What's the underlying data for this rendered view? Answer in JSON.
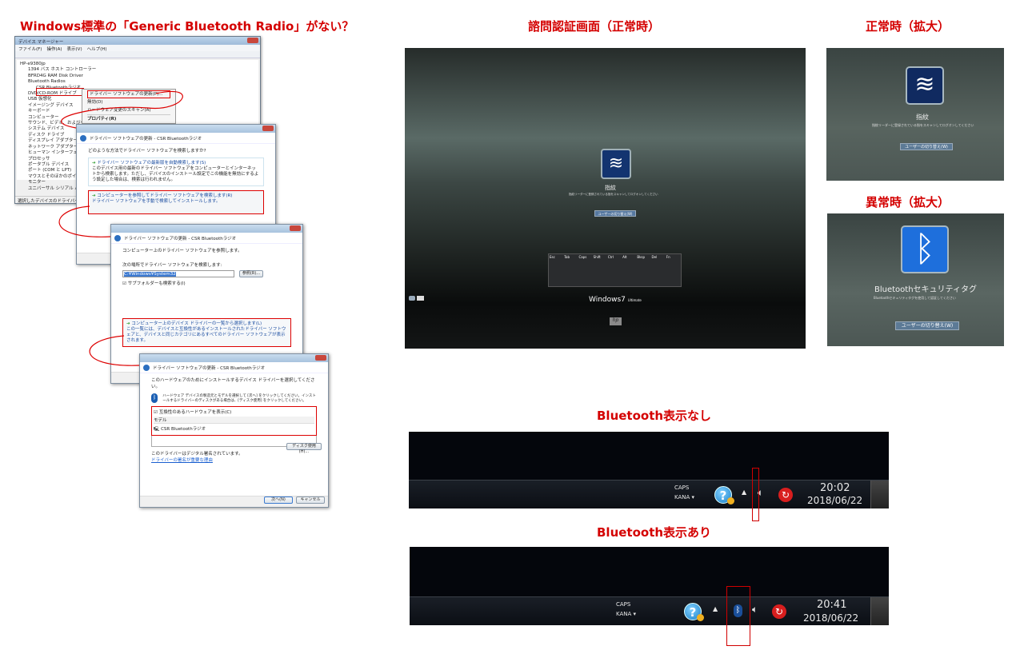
{
  "headings": {
    "left": "Windows標準の「Generic Bluetooth Radio」がない？",
    "center": "諮問認証画面（正常時）",
    "normal_zoom": "正常時（拡大）",
    "abnormal_zoom": "異常時（拡大）",
    "tray_without": "Bluetooth表示なし",
    "tray_with": "Bluetooth表示あり"
  },
  "device_manager": {
    "title": "デバイス マネージャー",
    "menu": [
      "ファイル(F)",
      "操作(A)",
      "表示(V)",
      "ヘルプ(H)"
    ],
    "tree": [
      "HP-e9380jp",
      "1394 バス ホスト コントローラー",
      "BFRD4G RAM Disk Driver",
      "Bluetooth Radios",
      "CSR Bluetoothラジオ",
      "DVD/CD-ROM ドライブ",
      "USB 仮想化",
      "イメージング デバイス",
      "キーボード",
      "コンピューター",
      "サウンド、ビデオ、およびゲーム",
      "システム デバイス",
      "ディスク ドライブ",
      "ディスプレイ アダプター",
      "ネットワーク アダプター",
      "ヒューマン インターフェイス",
      "プロセッサ",
      "ポータブル デバイス",
      "ポート (COM と LPT)",
      "マウスとそのほかのポインティング",
      "モニター",
      "ユニバーサル シリアル バス"
    ],
    "context_menu": [
      "ドライバー ソフトウェアの更新(P)...",
      "無効(D)",
      "ハードウェア変更のスキャン(A)",
      "プロパティ(R)"
    ],
    "status": "選択したデバイスのドライバー ソフトウェア"
  },
  "dialog1": {
    "title": "ドライバー ソフトウェアの更新 - CSR Bluetoothラジオ",
    "question": "どのような方法でドライバー ソフトウェアを検索しますか?",
    "opt1_title": "ドライバー ソフトウェアの最新版を自動検索します(S)",
    "opt1_desc": "このデバイス用の最新のドライバー ソフトウェアをコンピューターとインターネットから検索します。ただし、デバイスのインストール設定でこの機能を無効にするよう設定した場合は、検索は行われません。",
    "opt2_title": "コンピューターを参照してドライバー ソフトウェアを検索します(R)",
    "opt2_desc": "ドライバー ソフトウェアを手動で検索してインストールします。"
  },
  "dialog2": {
    "title": "ドライバー ソフトウェアの更新 - CSR Bluetoothラジオ",
    "heading": "コンピューター上のドライバー ソフトウェアを参照します。",
    "search_label": "次の場所でドライバー ソフトウェアを検索します:",
    "path_value": "C:¥Windows¥System32",
    "browse": "参照(R)...",
    "subfolder": "サブフォルダーも検索する(I)",
    "opt_title": "コンピューター上のデバイス ドライバーの一覧から選択します(L)",
    "opt_desc": "この一覧には、デバイスと互換性があるインストールされたドライバー ソフトウェアと、デバイスと同じカテゴリにあるすべてのドライバー ソフトウェアが表示されます。"
  },
  "dialog3": {
    "title": "ドライバー ソフトウェアの更新 - CSR Bluetoothラジオ",
    "heading": "このハードウェアのためにインストールするデバイス ドライバーを選択してください。",
    "desc": "ハードウェア デバイスの製造元とモデルを選択して [次へ] をクリックしてください。インストールするドライバーのディスクがある場合は、[ディスク使用] をクリックしてください。",
    "compatible": "互換性のあるハードウェアを表示(C)",
    "column": "モデル",
    "model": "CSR Bluetoothラジオ",
    "signed": "このドライバーはデジタル署名されています。",
    "link": "ドライバーの署名が重要な理由",
    "disk": "ディスク使用(H)...",
    "next": "次へ(N)",
    "cancel": "キャンセル"
  },
  "logon_main": {
    "label": "指紋",
    "hint": "指紋リーダーに登録されている指をスキャンしてログオンしてください",
    "switch_user": "ユーザーの切り替え(W)",
    "windows": "Windows7",
    "edition": "Ultimate",
    "brand": "hp",
    "keys": [
      "Esc",
      "Tab",
      "Caps",
      "Shift",
      "Ctrl",
      "Alt",
      "Bksp",
      "Del",
      "Fn"
    ]
  },
  "logon_normal": {
    "label": "指紋",
    "hint": "指紋リーダーに登録されている指をスキャンしてログオンしてください",
    "switch_user": "ユーザーの切り替え(W)"
  },
  "logon_abnormal": {
    "label": "Bluetoothセキュリティタグ",
    "hint": "Bluetoothセキュリティタグを使用して認証してください",
    "switch_user": "ユーザーの切り替え(W)"
  },
  "tray_without": {
    "caps": "CAPS",
    "kana": "KANA",
    "time": "20:02",
    "date": "2018/06/22"
  },
  "tray_with": {
    "caps": "CAPS",
    "kana": "KANA",
    "time": "20:41",
    "date": "2018/06/22"
  }
}
